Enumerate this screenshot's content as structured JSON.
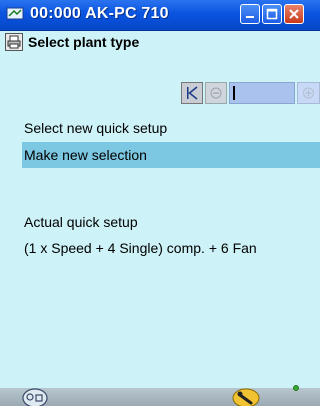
{
  "window": {
    "title": "00:000 AK-PC 710"
  },
  "header": {
    "page_title": "Select plant type"
  },
  "content": {
    "select_label": "Select new quick setup",
    "selection_item": "Make new selection",
    "actual_label": "Actual quick setup",
    "actual_value": "(1 x Speed + 4 Single) comp. + 6 Fan"
  },
  "icons": {
    "app": "network-icon",
    "page": "printer-icon",
    "minimize": "minimize-icon",
    "maximize": "maximize-icon",
    "close": "close-icon",
    "first": "first-page-icon",
    "prev": "previous-icon",
    "next": "next-icon",
    "bottom_left": "menu-icon",
    "bottom_tool": "wrench-icon",
    "status": "status-dot-icon"
  },
  "colors": {
    "background": "#cdf2f7",
    "titlebar": "#0a54e0",
    "selection": "#7cc7e1",
    "status_ok": "#39a832"
  }
}
